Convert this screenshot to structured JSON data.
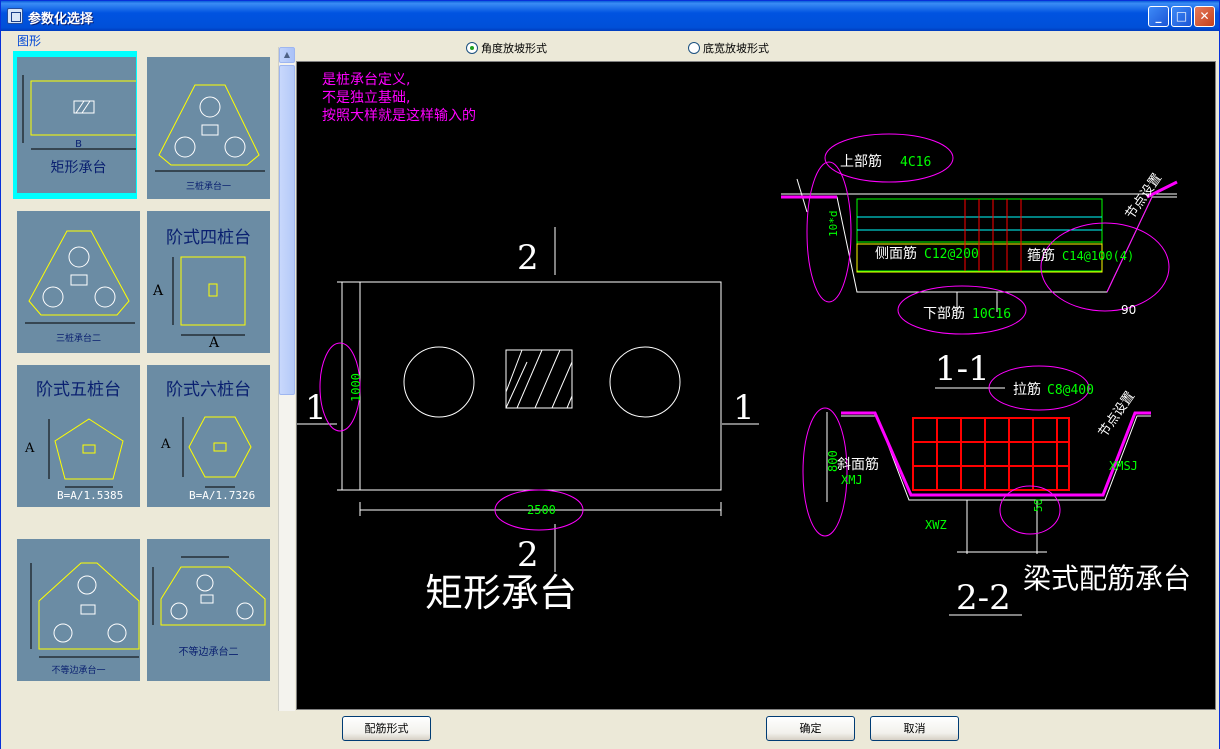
{
  "window": {
    "title": "参数化选择"
  },
  "left": {
    "group_label": "图形",
    "thumbs": [
      {
        "name": "矩形承台",
        "label_B": "B"
      },
      {
        "name": "三桩承台一"
      },
      {
        "name": "三桩承台二"
      },
      {
        "name": "阶式四桩台",
        "label_A": "A"
      },
      {
        "name": "阶式五桩台",
        "label_A": "A",
        "formula": "B=A/1.5385"
      },
      {
        "name": "阶式六桩台",
        "label_A": "A",
        "formula": "B=A/1.7326"
      },
      {
        "name": "不等边承台一"
      },
      {
        "name": "不等边承台二"
      }
    ]
  },
  "radios": [
    {
      "label": "角度放坡形式",
      "checked": true
    },
    {
      "label": "底宽放坡形式",
      "checked": false
    }
  ],
  "canvas": {
    "note_lines": [
      "是桩承台定义,",
      "不是独立基础,",
      "按照大样就是这样输入的"
    ],
    "main_title": "矩形承台",
    "section_mark_2": "2",
    "section_mark_1": "1",
    "dim_height": "1000",
    "dim_width": "2500",
    "section_1_1": "1-1",
    "section_2_2": "2-2",
    "beam_title": "梁式配筋承台",
    "top_rebar_label": "上部筋",
    "top_rebar_value": "4C16",
    "side_rebar_label": "侧面筋",
    "side_rebar_value": "C12@200",
    "stirrup_label": "箍筋",
    "stirrup_value": "C14@100(4)",
    "bottom_rebar_label": "下部筋",
    "bottom_rebar_value": "10C16",
    "anchor_text": "10*d",
    "node_setting": "节点设置",
    "angle": "90",
    "tie_label": "拉筋",
    "tie_value": "C8@400",
    "slope_label": "斜面筋",
    "slope_value": "XMJ",
    "xmsj": "XMSJ",
    "xwz": "XWZ",
    "dim_800": "800",
    "dim_50": "50"
  },
  "buttons": {
    "rebar_form": "配筋形式",
    "ok": "确定",
    "cancel": "取消"
  },
  "colors": {
    "titlebar": "#0053e1",
    "canvas_bg": "#000000",
    "cad_green": "#00ff00",
    "cad_magenta": "#ff00ff",
    "cad_yellow": "#ffff00",
    "cad_red": "#ff0000",
    "thumb_bg": "#6b8ca4",
    "selected": "#00ffff"
  }
}
